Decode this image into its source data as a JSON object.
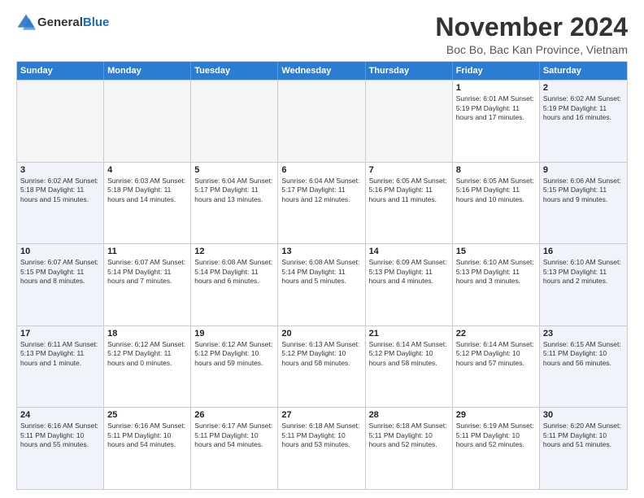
{
  "logo": {
    "general": "General",
    "blue": "Blue"
  },
  "title": "November 2024",
  "location": "Boc Bo, Bac Kan Province, Vietnam",
  "header": {
    "days": [
      "Sunday",
      "Monday",
      "Tuesday",
      "Wednesday",
      "Thursday",
      "Friday",
      "Saturday"
    ]
  },
  "weeks": [
    [
      {
        "day": "",
        "empty": true
      },
      {
        "day": "",
        "empty": true
      },
      {
        "day": "",
        "empty": true
      },
      {
        "day": "",
        "empty": true
      },
      {
        "day": "",
        "empty": true
      },
      {
        "day": "1",
        "info": "Sunrise: 6:01 AM\nSunset: 5:19 PM\nDaylight: 11 hours and 17 minutes."
      },
      {
        "day": "2",
        "info": "Sunrise: 6:02 AM\nSunset: 5:19 PM\nDaylight: 11 hours and 16 minutes."
      }
    ],
    [
      {
        "day": "3",
        "info": "Sunrise: 6:02 AM\nSunset: 5:18 PM\nDaylight: 11 hours and 15 minutes."
      },
      {
        "day": "4",
        "info": "Sunrise: 6:03 AM\nSunset: 5:18 PM\nDaylight: 11 hours and 14 minutes."
      },
      {
        "day": "5",
        "info": "Sunrise: 6:04 AM\nSunset: 5:17 PM\nDaylight: 11 hours and 13 minutes."
      },
      {
        "day": "6",
        "info": "Sunrise: 6:04 AM\nSunset: 5:17 PM\nDaylight: 11 hours and 12 minutes."
      },
      {
        "day": "7",
        "info": "Sunrise: 6:05 AM\nSunset: 5:16 PM\nDaylight: 11 hours and 11 minutes."
      },
      {
        "day": "8",
        "info": "Sunrise: 6:05 AM\nSunset: 5:16 PM\nDaylight: 11 hours and 10 minutes."
      },
      {
        "day": "9",
        "info": "Sunrise: 6:06 AM\nSunset: 5:15 PM\nDaylight: 11 hours and 9 minutes."
      }
    ],
    [
      {
        "day": "10",
        "info": "Sunrise: 6:07 AM\nSunset: 5:15 PM\nDaylight: 11 hours and 8 minutes."
      },
      {
        "day": "11",
        "info": "Sunrise: 6:07 AM\nSunset: 5:14 PM\nDaylight: 11 hours and 7 minutes."
      },
      {
        "day": "12",
        "info": "Sunrise: 6:08 AM\nSunset: 5:14 PM\nDaylight: 11 hours and 6 minutes."
      },
      {
        "day": "13",
        "info": "Sunrise: 6:08 AM\nSunset: 5:14 PM\nDaylight: 11 hours and 5 minutes."
      },
      {
        "day": "14",
        "info": "Sunrise: 6:09 AM\nSunset: 5:13 PM\nDaylight: 11 hours and 4 minutes."
      },
      {
        "day": "15",
        "info": "Sunrise: 6:10 AM\nSunset: 5:13 PM\nDaylight: 11 hours and 3 minutes."
      },
      {
        "day": "16",
        "info": "Sunrise: 6:10 AM\nSunset: 5:13 PM\nDaylight: 11 hours and 2 minutes."
      }
    ],
    [
      {
        "day": "17",
        "info": "Sunrise: 6:11 AM\nSunset: 5:13 PM\nDaylight: 11 hours and 1 minute."
      },
      {
        "day": "18",
        "info": "Sunrise: 6:12 AM\nSunset: 5:12 PM\nDaylight: 11 hours and 0 minutes."
      },
      {
        "day": "19",
        "info": "Sunrise: 6:12 AM\nSunset: 5:12 PM\nDaylight: 10 hours and 59 minutes."
      },
      {
        "day": "20",
        "info": "Sunrise: 6:13 AM\nSunset: 5:12 PM\nDaylight: 10 hours and 58 minutes."
      },
      {
        "day": "21",
        "info": "Sunrise: 6:14 AM\nSunset: 5:12 PM\nDaylight: 10 hours and 58 minutes."
      },
      {
        "day": "22",
        "info": "Sunrise: 6:14 AM\nSunset: 5:12 PM\nDaylight: 10 hours and 57 minutes."
      },
      {
        "day": "23",
        "info": "Sunrise: 6:15 AM\nSunset: 5:11 PM\nDaylight: 10 hours and 56 minutes."
      }
    ],
    [
      {
        "day": "24",
        "info": "Sunrise: 6:16 AM\nSunset: 5:11 PM\nDaylight: 10 hours and 55 minutes."
      },
      {
        "day": "25",
        "info": "Sunrise: 6:16 AM\nSunset: 5:11 PM\nDaylight: 10 hours and 54 minutes."
      },
      {
        "day": "26",
        "info": "Sunrise: 6:17 AM\nSunset: 5:11 PM\nDaylight: 10 hours and 54 minutes."
      },
      {
        "day": "27",
        "info": "Sunrise: 6:18 AM\nSunset: 5:11 PM\nDaylight: 10 hours and 53 minutes."
      },
      {
        "day": "28",
        "info": "Sunrise: 6:18 AM\nSunset: 5:11 PM\nDaylight: 10 hours and 52 minutes."
      },
      {
        "day": "29",
        "info": "Sunrise: 6:19 AM\nSunset: 5:11 PM\nDaylight: 10 hours and 52 minutes."
      },
      {
        "day": "30",
        "info": "Sunrise: 6:20 AM\nSunset: 5:11 PM\nDaylight: 10 hours and 51 minutes."
      }
    ]
  ]
}
